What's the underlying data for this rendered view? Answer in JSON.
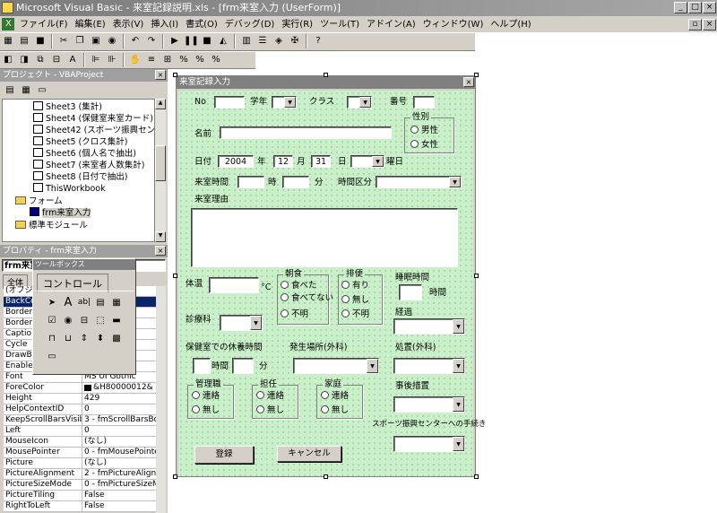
{
  "window": {
    "title": "Microsoft Visual Basic - 来室記録説明.xls - [frm来室入力 (UserForm)]"
  },
  "menu": [
    "ファイル(F)",
    "編集(E)",
    "表示(V)",
    "挿入(I)",
    "書式(O)",
    "デバッグ(D)",
    "実行(R)",
    "ツール(T)",
    "アドイン(A)",
    "ウィンドウ(W)",
    "ヘルプ(H)"
  ],
  "project": {
    "title": "プロジェクト - VBAProject",
    "items": [
      "Sheet3 (集計)",
      "Sheet4 (保健室来室カード)",
      "Sheet42 (スポーツ振興センター)",
      "Sheet5 (クロス集計)",
      "Sheet6 (個人名で抽出)",
      "Sheet7 (来室者人数集計)",
      "Sheet8 (日付で抽出)",
      "ThisWorkbook",
      "フォーム",
      "frm来室入力",
      "標準モジュール"
    ]
  },
  "properties": {
    "title": "プロパティ - frm来室入力",
    "object": "frm来室",
    "tab": "全体",
    "rows": [
      {
        "n": "(オブジ",
        "v": ""
      },
      {
        "n": "BackCo",
        "v": ""
      },
      {
        "n": "Border",
        "v": "2&"
      },
      {
        "n": "Border",
        "v": "yleN"
      },
      {
        "n": "Captio",
        "v": ""
      },
      {
        "n": "Cycle",
        "v": "Forr"
      },
      {
        "n": "DrawB",
        "v": ""
      },
      {
        "n": "Enable",
        "v": ""
      },
      {
        "n": "Font",
        "v": "MS UI Gothic"
      },
      {
        "n": "ForeColor",
        "v": "&H80000012&"
      },
      {
        "n": "Height",
        "v": "429"
      },
      {
        "n": "HelpContextID",
        "v": "0"
      },
      {
        "n": "KeepScrollBarsVisib",
        "v": "3 - fmScrollBarsBo"
      },
      {
        "n": "Left",
        "v": "0"
      },
      {
        "n": "MouseIcon",
        "v": "(なし)"
      },
      {
        "n": "MousePointer",
        "v": "0 - fmMousePointe"
      },
      {
        "n": "Picture",
        "v": "(なし)"
      },
      {
        "n": "PictureAlignment",
        "v": "2 - fmPictureAlign"
      },
      {
        "n": "PictureSizeMode",
        "v": "0 - fmPictureSizeM"
      },
      {
        "n": "PictureTiling",
        "v": "False"
      },
      {
        "n": "RightToLeft",
        "v": "False"
      }
    ]
  },
  "toolbox": {
    "title": "ツールボックス",
    "tab": "コントロール"
  },
  "form": {
    "title": "来室記録入力",
    "no": "No",
    "grade": "学年",
    "class": "クラス",
    "number": "番号",
    "gender": "性別",
    "male": "男性",
    "female": "女性",
    "name": "名前",
    "date": "日付",
    "year_val": "2004",
    "year": "年",
    "month_val": "12",
    "month": "月",
    "day_val": "31",
    "day": "日",
    "weekday": "曜日",
    "visit_time": "来室時間",
    "hour": "時",
    "minute": "分",
    "period": "時間区分",
    "reason": "来室理由",
    "temp": "体温",
    "celsius": "°C",
    "breakfast": "朝食",
    "ate": "食べた",
    "not_ate": "食べてない",
    "unknown": "不明",
    "stool": "排便",
    "yes": "有り",
    "none": "無し",
    "sleep": "睡眠時間",
    "hours": "時間",
    "clinic": "診療科",
    "progress": "経過",
    "rest": "保健室での休養時間",
    "rest_hours": "時間",
    "rest_min": "分",
    "place": "発生場所(外科)",
    "treatment": "処置(外科)",
    "admin": "管理職",
    "teacher": "担任",
    "family": "家庭",
    "contact": "連絡",
    "nocontact": "無し",
    "after": "事後措置",
    "sports": "スポーツ振興センターへの手続き",
    "register": "登録",
    "cancel": "キャンセル"
  }
}
